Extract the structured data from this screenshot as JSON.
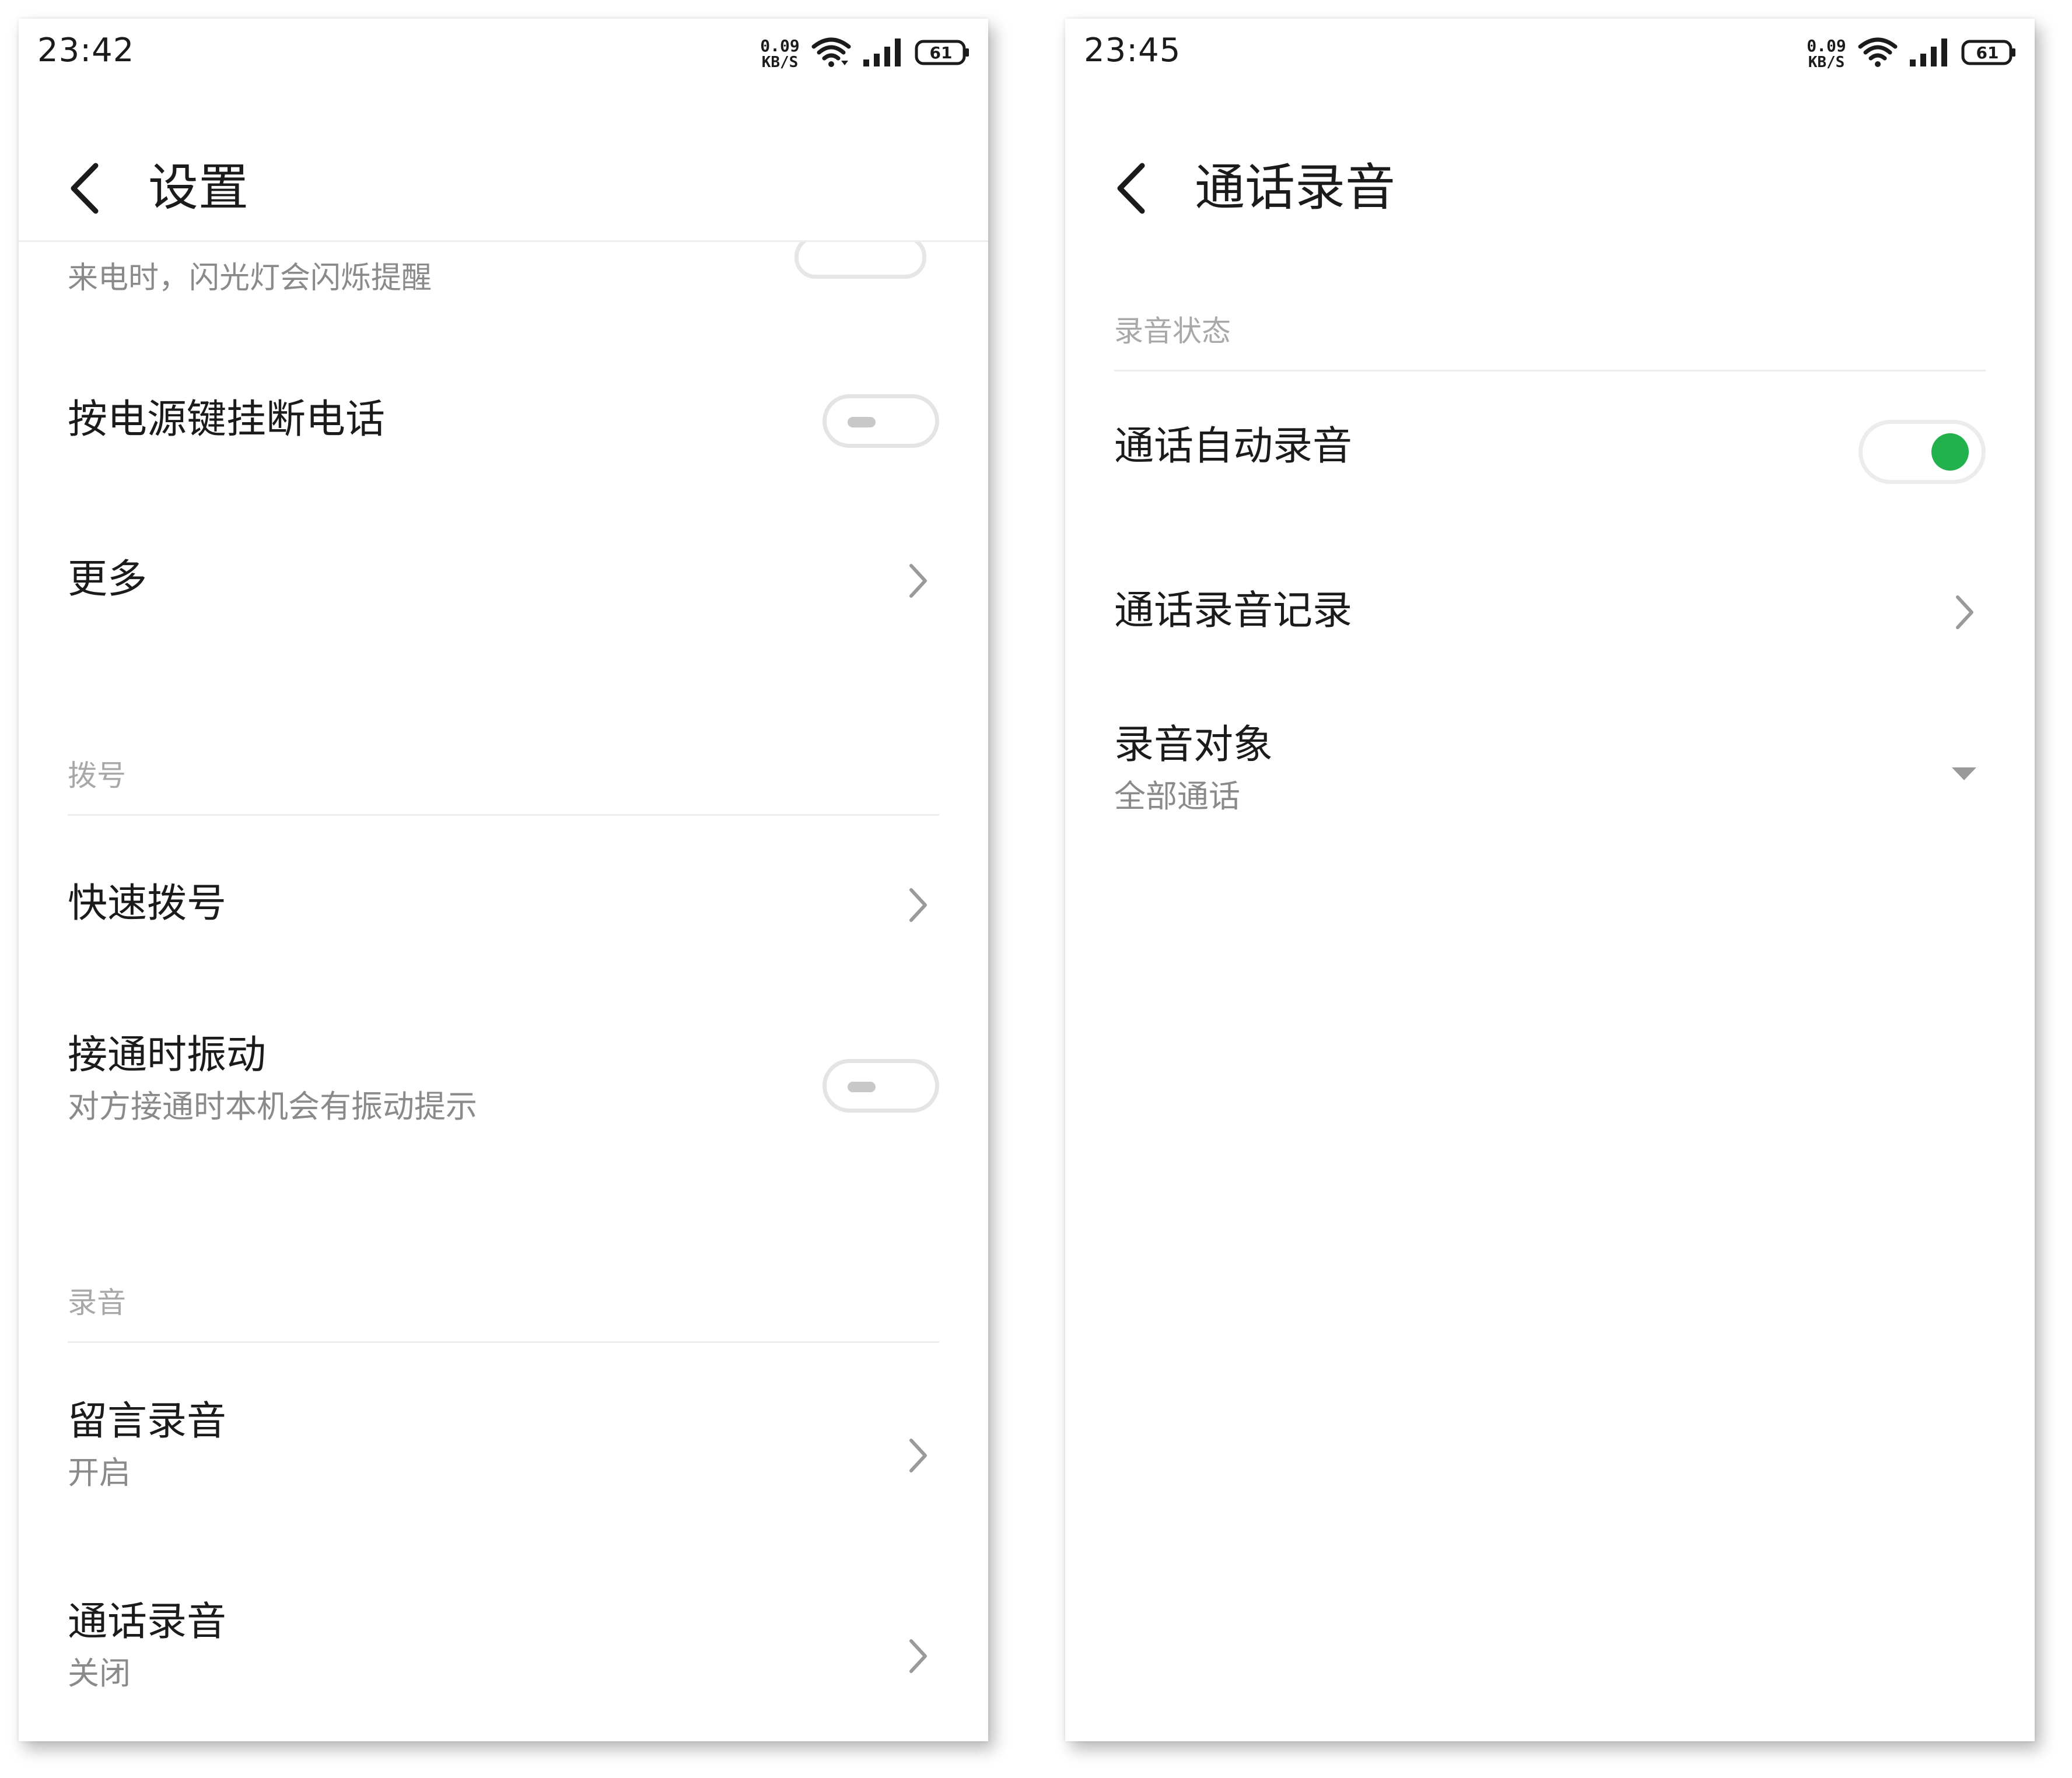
{
  "left": {
    "status": {
      "time": "23:42",
      "net_value": "0.09",
      "net_unit": "KB/S",
      "battery": "61"
    },
    "title": "设置",
    "scroll_hint": "来电时，闪光灯会闪烁提醒",
    "rows": {
      "power_hangup": {
        "title": "按电源键挂断电话",
        "toggle": false
      },
      "more": {
        "title": "更多"
      },
      "section_dial": "拨号",
      "speed_dial": {
        "title": "快速拨号"
      },
      "vibrate_on_connect": {
        "title": "接通时振动",
        "subtitle": "对方接通时本机会有振动提示",
        "toggle": false
      },
      "section_record": "录音",
      "voicemail_record": {
        "title": "留言录音",
        "subtitle": "开启"
      },
      "call_record": {
        "title": "通话录音",
        "subtitle": "关闭"
      }
    }
  },
  "right": {
    "status": {
      "time": "23:45",
      "net_value": "0.09",
      "net_unit": "KB/S",
      "battery": "61"
    },
    "title": "通话录音",
    "section_status": "录音状态",
    "rows": {
      "auto_record": {
        "title": "通话自动录音",
        "toggle": true
      },
      "record_list": {
        "title": "通话录音记录"
      },
      "record_target": {
        "title": "录音对象",
        "value": "全部通话"
      }
    }
  },
  "colors": {
    "accent_on": "#22b14c",
    "text_primary": "#1b1b1b",
    "text_secondary": "#8a8a8a"
  }
}
